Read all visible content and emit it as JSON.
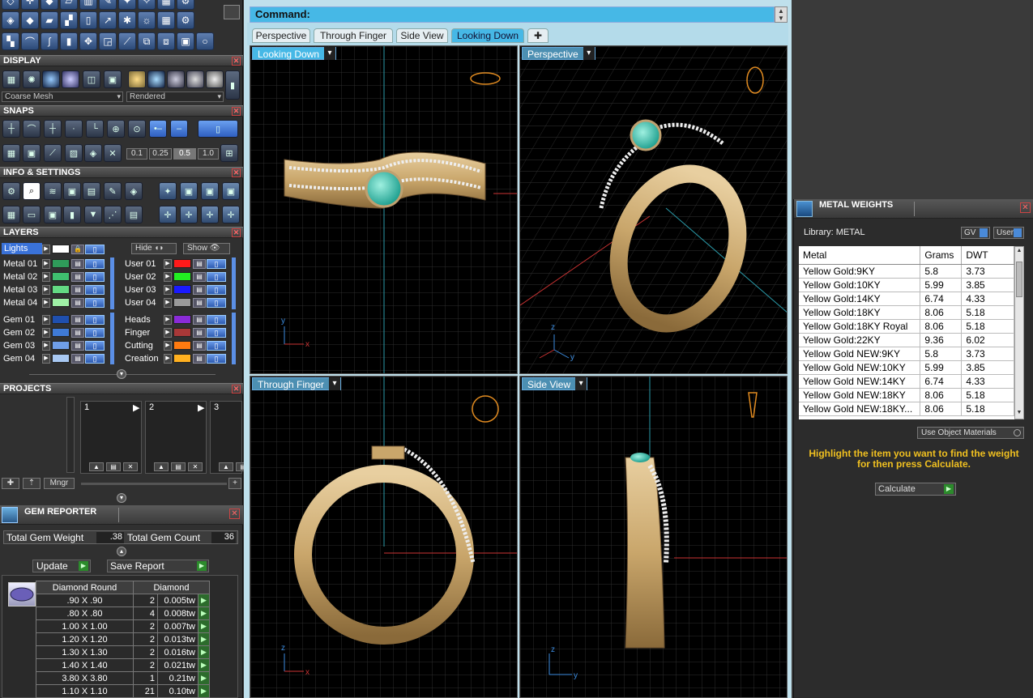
{
  "display": {
    "title": "DISPLAY",
    "mesh": "Coarse Mesh",
    "render": "Rendered"
  },
  "snaps": {
    "title": "SNAPS",
    "values": [
      "0.1",
      "0.25",
      "0.5",
      "1.0"
    ]
  },
  "info": {
    "title": "INFO & SETTINGS"
  },
  "layers": {
    "title": "LAYERS",
    "lights": "Lights",
    "hide": "Hide",
    "show": "Show",
    "left": [
      {
        "name": "Metal 01",
        "color": "#2f9b5a"
      },
      {
        "name": "Metal 02",
        "color": "#3fbf6f"
      },
      {
        "name": "Metal 03",
        "color": "#63d983"
      },
      {
        "name": "Metal 04",
        "color": "#9ff0a6"
      },
      {
        "name": "Gem 01",
        "color": "#1f4fae"
      },
      {
        "name": "Gem 02",
        "color": "#3f7ad6"
      },
      {
        "name": "Gem 03",
        "color": "#6f9ee8"
      },
      {
        "name": "Gem 04",
        "color": "#a8c8f2"
      }
    ],
    "right": [
      {
        "name": "User 01",
        "color": "#ff1a1a"
      },
      {
        "name": "User 02",
        "color": "#22ee22"
      },
      {
        "name": "User 03",
        "color": "#1a1aff"
      },
      {
        "name": "User 04",
        "color": "#9a9a9a"
      },
      {
        "name": "Heads",
        "color": "#8a2bd8"
      },
      {
        "name": "Finger",
        "color": "#a83838"
      },
      {
        "name": "Cutting",
        "color": "#ff7a10"
      },
      {
        "name": "Creation",
        "color": "#ffb020"
      }
    ]
  },
  "projects": {
    "title": "PROJECTS",
    "slots": [
      "1",
      "2",
      "3"
    ],
    "mngr": "Mngr"
  },
  "gem_reporter": {
    "title": "GEM REPORTER",
    "total_weight_label": "Total Gem Weight",
    "total_weight": ".38",
    "total_count_label": "Total Gem Count",
    "total_count": "36",
    "update": "Update",
    "save_report": "Save Report",
    "col_shape": "Diamond Round",
    "col_material": "Diamond",
    "rows": [
      {
        "size": ".90 X .90",
        "count": "2",
        "tw": "0.005tw"
      },
      {
        "size": ".80 X .80",
        "count": "4",
        "tw": "0.008tw"
      },
      {
        "size": "1.00 X 1.00",
        "count": "2",
        "tw": "0.007tw"
      },
      {
        "size": "1.20 X 1.20",
        "count": "2",
        "tw": "0.013tw"
      },
      {
        "size": "1.30 X 1.30",
        "count": "2",
        "tw": "0.016tw"
      },
      {
        "size": "1.40 X 1.40",
        "count": "2",
        "tw": "0.021tw"
      },
      {
        "size": "3.80 X 3.80",
        "count": "1",
        "tw": "0.21tw"
      },
      {
        "size": "1.10 X 1.10",
        "count": "21",
        "tw": "0.10tw"
      }
    ]
  },
  "command": {
    "label": "Command:"
  },
  "tabs": [
    "Perspective",
    "Through Finger",
    "Side View",
    "Looking Down"
  ],
  "viewports": {
    "top_left": "Looking Down",
    "top_right": "Perspective",
    "bottom_left": "Through Finger",
    "bottom_right": "Side View"
  },
  "metal_weights": {
    "title": "METAL WEIGHTS",
    "library": "Library: METAL",
    "gv": "GV",
    "user": "User",
    "columns": [
      "Metal",
      "Grams",
      "DWT"
    ],
    "rows": [
      [
        "Yellow Gold:9KY",
        "5.8",
        "3.73"
      ],
      [
        "Yellow Gold:10KY",
        "5.99",
        "3.85"
      ],
      [
        "Yellow Gold:14KY",
        "6.74",
        "4.33"
      ],
      [
        "Yellow Gold:18KY",
        "8.06",
        "5.18"
      ],
      [
        "Yellow Gold:18KY Royal",
        "8.06",
        "5.18"
      ],
      [
        "Yellow Gold:22KY",
        "9.36",
        "6.02"
      ],
      [
        "Yellow Gold NEW:9KY",
        "5.8",
        "3.73"
      ],
      [
        "Yellow Gold NEW:10KY",
        "5.99",
        "3.85"
      ],
      [
        "Yellow Gold NEW:14KY",
        "6.74",
        "4.33"
      ],
      [
        "Yellow Gold NEW:18KY",
        "8.06",
        "5.18"
      ],
      [
        "Yellow Gold NEW:18KY...",
        "8.06",
        "5.18"
      ]
    ],
    "use_object_materials": "Use Object Materials",
    "hint": "Highlight the item you want to find the weight for then press Calculate.",
    "calculate": "Calculate"
  },
  "colors": {
    "accent": "#46b8e6",
    "hint": "#f0c020",
    "gold": "#c9a66b",
    "gem": "#3fc7b0"
  }
}
